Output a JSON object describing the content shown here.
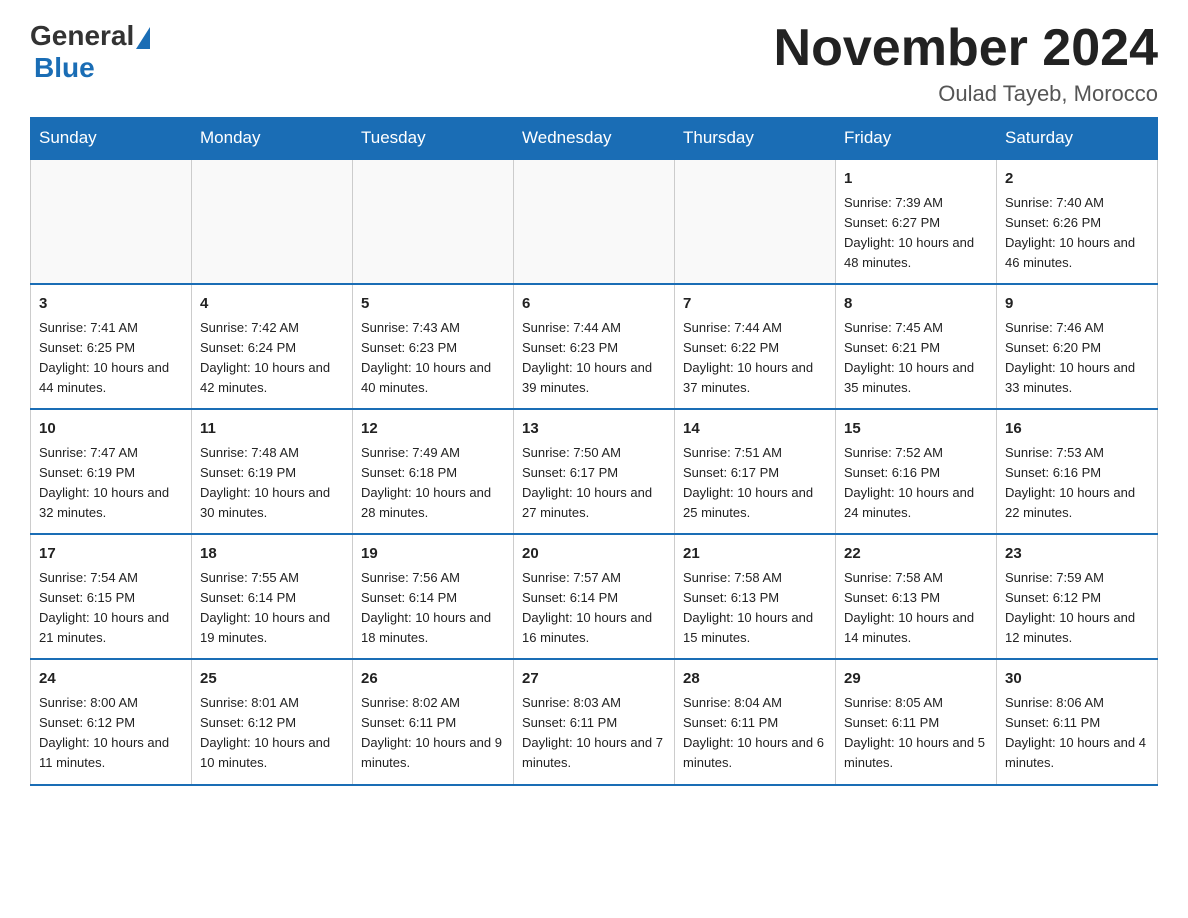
{
  "header": {
    "logo_general": "General",
    "logo_blue": "Blue",
    "month_year": "November 2024",
    "location": "Oulad Tayeb, Morocco"
  },
  "days_of_week": [
    "Sunday",
    "Monday",
    "Tuesday",
    "Wednesday",
    "Thursday",
    "Friday",
    "Saturday"
  ],
  "weeks": [
    [
      {
        "day": "",
        "info": ""
      },
      {
        "day": "",
        "info": ""
      },
      {
        "day": "",
        "info": ""
      },
      {
        "day": "",
        "info": ""
      },
      {
        "day": "",
        "info": ""
      },
      {
        "day": "1",
        "info": "Sunrise: 7:39 AM\nSunset: 6:27 PM\nDaylight: 10 hours and 48 minutes."
      },
      {
        "day": "2",
        "info": "Sunrise: 7:40 AM\nSunset: 6:26 PM\nDaylight: 10 hours and 46 minutes."
      }
    ],
    [
      {
        "day": "3",
        "info": "Sunrise: 7:41 AM\nSunset: 6:25 PM\nDaylight: 10 hours and 44 minutes."
      },
      {
        "day": "4",
        "info": "Sunrise: 7:42 AM\nSunset: 6:24 PM\nDaylight: 10 hours and 42 minutes."
      },
      {
        "day": "5",
        "info": "Sunrise: 7:43 AM\nSunset: 6:23 PM\nDaylight: 10 hours and 40 minutes."
      },
      {
        "day": "6",
        "info": "Sunrise: 7:44 AM\nSunset: 6:23 PM\nDaylight: 10 hours and 39 minutes."
      },
      {
        "day": "7",
        "info": "Sunrise: 7:44 AM\nSunset: 6:22 PM\nDaylight: 10 hours and 37 minutes."
      },
      {
        "day": "8",
        "info": "Sunrise: 7:45 AM\nSunset: 6:21 PM\nDaylight: 10 hours and 35 minutes."
      },
      {
        "day": "9",
        "info": "Sunrise: 7:46 AM\nSunset: 6:20 PM\nDaylight: 10 hours and 33 minutes."
      }
    ],
    [
      {
        "day": "10",
        "info": "Sunrise: 7:47 AM\nSunset: 6:19 PM\nDaylight: 10 hours and 32 minutes."
      },
      {
        "day": "11",
        "info": "Sunrise: 7:48 AM\nSunset: 6:19 PM\nDaylight: 10 hours and 30 minutes."
      },
      {
        "day": "12",
        "info": "Sunrise: 7:49 AM\nSunset: 6:18 PM\nDaylight: 10 hours and 28 minutes."
      },
      {
        "day": "13",
        "info": "Sunrise: 7:50 AM\nSunset: 6:17 PM\nDaylight: 10 hours and 27 minutes."
      },
      {
        "day": "14",
        "info": "Sunrise: 7:51 AM\nSunset: 6:17 PM\nDaylight: 10 hours and 25 minutes."
      },
      {
        "day": "15",
        "info": "Sunrise: 7:52 AM\nSunset: 6:16 PM\nDaylight: 10 hours and 24 minutes."
      },
      {
        "day": "16",
        "info": "Sunrise: 7:53 AM\nSunset: 6:16 PM\nDaylight: 10 hours and 22 minutes."
      }
    ],
    [
      {
        "day": "17",
        "info": "Sunrise: 7:54 AM\nSunset: 6:15 PM\nDaylight: 10 hours and 21 minutes."
      },
      {
        "day": "18",
        "info": "Sunrise: 7:55 AM\nSunset: 6:14 PM\nDaylight: 10 hours and 19 minutes."
      },
      {
        "day": "19",
        "info": "Sunrise: 7:56 AM\nSunset: 6:14 PM\nDaylight: 10 hours and 18 minutes."
      },
      {
        "day": "20",
        "info": "Sunrise: 7:57 AM\nSunset: 6:14 PM\nDaylight: 10 hours and 16 minutes."
      },
      {
        "day": "21",
        "info": "Sunrise: 7:58 AM\nSunset: 6:13 PM\nDaylight: 10 hours and 15 minutes."
      },
      {
        "day": "22",
        "info": "Sunrise: 7:58 AM\nSunset: 6:13 PM\nDaylight: 10 hours and 14 minutes."
      },
      {
        "day": "23",
        "info": "Sunrise: 7:59 AM\nSunset: 6:12 PM\nDaylight: 10 hours and 12 minutes."
      }
    ],
    [
      {
        "day": "24",
        "info": "Sunrise: 8:00 AM\nSunset: 6:12 PM\nDaylight: 10 hours and 11 minutes."
      },
      {
        "day": "25",
        "info": "Sunrise: 8:01 AM\nSunset: 6:12 PM\nDaylight: 10 hours and 10 minutes."
      },
      {
        "day": "26",
        "info": "Sunrise: 8:02 AM\nSunset: 6:11 PM\nDaylight: 10 hours and 9 minutes."
      },
      {
        "day": "27",
        "info": "Sunrise: 8:03 AM\nSunset: 6:11 PM\nDaylight: 10 hours and 7 minutes."
      },
      {
        "day": "28",
        "info": "Sunrise: 8:04 AM\nSunset: 6:11 PM\nDaylight: 10 hours and 6 minutes."
      },
      {
        "day": "29",
        "info": "Sunrise: 8:05 AM\nSunset: 6:11 PM\nDaylight: 10 hours and 5 minutes."
      },
      {
        "day": "30",
        "info": "Sunrise: 8:06 AM\nSunset: 6:11 PM\nDaylight: 10 hours and 4 minutes."
      }
    ]
  ]
}
